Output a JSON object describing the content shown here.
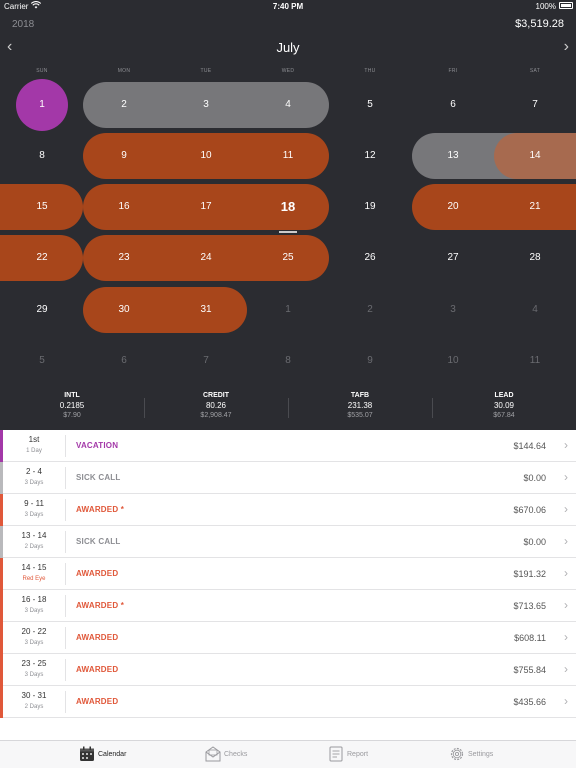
{
  "status_bar": {
    "carrier": "Carrier",
    "time": "7:40 PM",
    "battery": "100%"
  },
  "header": {
    "year": "2018",
    "month": "July",
    "earnings": "$3,519.28",
    "prev": "‹",
    "next": "›"
  },
  "weekdays": [
    "SUN",
    "MON",
    "TUE",
    "WED",
    "THU",
    "FRI",
    "SAT"
  ],
  "weeks": [
    [
      "1",
      "2",
      "3",
      "4",
      "5",
      "6",
      "7"
    ],
    [
      "8",
      "9",
      "10",
      "11",
      "12",
      "13",
      "14"
    ],
    [
      "15",
      "16",
      "17",
      "18",
      "19",
      "20",
      "21"
    ],
    [
      "22",
      "23",
      "24",
      "25",
      "26",
      "27",
      "28"
    ],
    [
      "29",
      "30",
      "31",
      "1",
      "2",
      "3",
      "4"
    ],
    [
      "5",
      "6",
      "7",
      "8",
      "9",
      "10",
      "11"
    ]
  ],
  "today": "18",
  "colors": {
    "vacation": "#a338a8",
    "awarded": "#a8461b",
    "sick": "#77777a",
    "awarded_text": "#e0583a",
    "vacation_text": "#a338a8"
  },
  "stats": [
    {
      "label": "INTL",
      "value": "0.2185",
      "amount": "$7.90"
    },
    {
      "label": "CREDIT",
      "value": "80.26",
      "amount": "$2,908.47"
    },
    {
      "label": "TAFB",
      "value": "231.38",
      "amount": "$535.07"
    },
    {
      "label": "LEAD",
      "value": "30.09",
      "amount": "$67.84"
    }
  ],
  "events": [
    {
      "dates": "1st",
      "sub": "1 Day",
      "type": "VACATION",
      "amount": "$144.64"
    },
    {
      "dates": "2 - 4",
      "sub": "3 Days",
      "type": "SICK CALL",
      "amount": "$0.00"
    },
    {
      "dates": "9 - 11",
      "sub": "3 Days",
      "type": "AWARDED *",
      "amount": "$670.06"
    },
    {
      "dates": "13 - 14",
      "sub": "2 Days",
      "type": "SICK CALL",
      "amount": "$0.00"
    },
    {
      "dates": "14 - 15",
      "sub": "Red Eye",
      "type": "AWARDED",
      "amount": "$191.32"
    },
    {
      "dates": "16 - 18",
      "sub": "3 Days",
      "type": "AWARDED *",
      "amount": "$713.65"
    },
    {
      "dates": "20 - 22",
      "sub": "3 Days",
      "type": "AWARDED",
      "amount": "$608.11"
    },
    {
      "dates": "23 - 25",
      "sub": "3 Days",
      "type": "AWARDED",
      "amount": "$755.84"
    },
    {
      "dates": "30 - 31",
      "sub": "2 Days",
      "type": "AWARDED",
      "amount": "$435.66"
    }
  ],
  "tabs": [
    {
      "label": "Calendar",
      "icon": "calendar-icon"
    },
    {
      "label": "Checks",
      "icon": "checks-icon"
    },
    {
      "label": "Report",
      "icon": "report-icon"
    },
    {
      "label": "Settings",
      "icon": "settings-icon"
    }
  ]
}
